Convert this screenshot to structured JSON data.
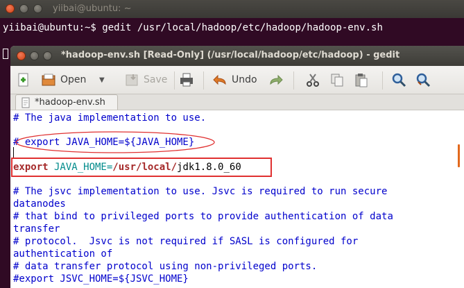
{
  "terminal": {
    "title": "yiibai@ubuntu: ~",
    "prompt": "yiibai@ubuntu:~$",
    "command": "gedit /usr/local/hadoop/etc/hadoop/hadoop-env.sh"
  },
  "gedit": {
    "title": "*hadoop-env.sh [Read-Only] (/usr/local/hadoop/etc/hadoop) - gedit",
    "toolbar": {
      "open_label": "Open",
      "save_label": "Save",
      "undo_label": "Undo"
    },
    "tab_label": "*hadoop-env.sh",
    "lines": {
      "l1": "# The java implementation to use.",
      "l2": "# export JAVA_HOME=${JAVA_HOME}",
      "l3_kw": "export",
      "l3_var": " JAVA_HOME=",
      "l3_p1": "/usr/",
      "l3_p2": "local",
      "l3_p3": "/",
      "l3_p4": "jdk1.8.0_60",
      "l4": "# The jsvc implementation to use. Jsvc is required to run secure",
      "l5": "datanodes",
      "l6": "# that bind to privileged ports to provide authentication of data",
      "l7": "transfer",
      "l8": "# protocol.  Jsvc is not required if SASL is configured for",
      "l9": "authentication of",
      "l10": "# data transfer protocol using non-privileged ports.",
      "l11": "#export JSVC_HOME=${JSVC_HOME}"
    }
  },
  "colors": {
    "terminal_bg": "#300a24",
    "comment": "#0000cc",
    "keyword": "#a52a2a",
    "variable": "#008b8b",
    "highlight": "#e03030"
  }
}
